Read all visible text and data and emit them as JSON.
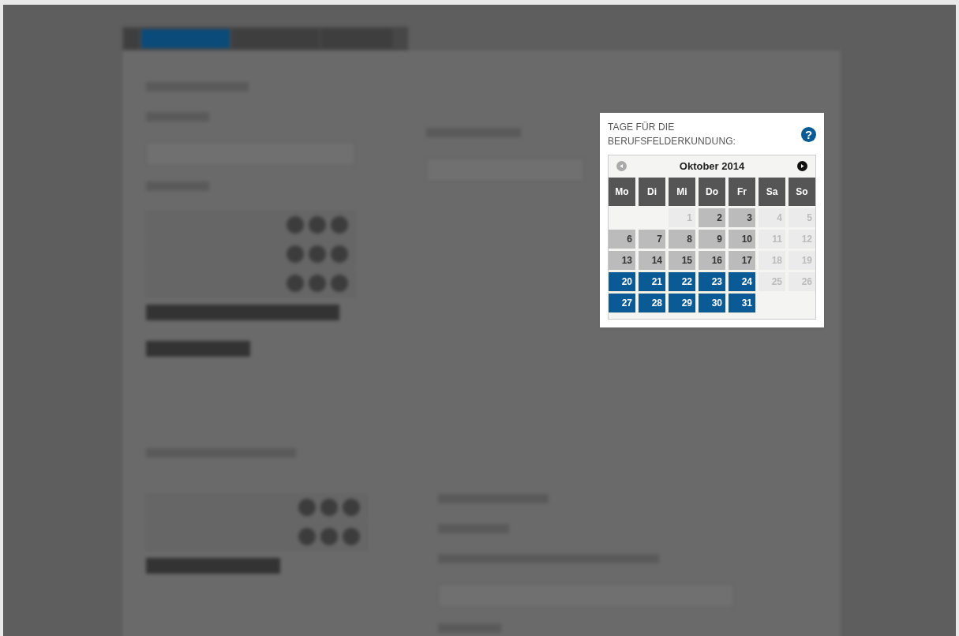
{
  "popup": {
    "title": "TAGE FÜR DIE BERUFSFELDERKUNDUNG:",
    "help": "?"
  },
  "calendar": {
    "month": "Oktober 2014",
    "prev_disabled": true,
    "next_disabled": false,
    "weekdays": [
      "Mo",
      "Di",
      "Mi",
      "Do",
      "Fr",
      "Sa",
      "So"
    ],
    "weeks": [
      {
        "days": [
          {
            "label": "1",
            "kind": "unavailable",
            "selected": false
          },
          {
            "label": "2",
            "kind": "available",
            "selected": false
          },
          {
            "label": "3",
            "kind": "available",
            "selected": false
          },
          {
            "label": "4",
            "kind": "unavailable",
            "selected": false
          },
          {
            "label": "5",
            "kind": "unavailable",
            "selected": false
          }
        ]
      },
      {
        "days": [
          {
            "label": "6",
            "kind": "available",
            "selected": false
          },
          {
            "label": "7",
            "kind": "available",
            "selected": false
          },
          {
            "label": "8",
            "kind": "available",
            "selected": false
          },
          {
            "label": "9",
            "kind": "available",
            "selected": false
          },
          {
            "label": "10",
            "kind": "available",
            "selected": false
          },
          {
            "label": "11",
            "kind": "unavailable",
            "selected": false
          },
          {
            "label": "12",
            "kind": "unavailable",
            "selected": false
          }
        ]
      },
      {
        "days": [
          {
            "label": "13",
            "kind": "available",
            "selected": false
          },
          {
            "label": "14",
            "kind": "available",
            "selected": false
          },
          {
            "label": "15",
            "kind": "available",
            "selected": false
          },
          {
            "label": "16",
            "kind": "available",
            "selected": false
          },
          {
            "label": "17",
            "kind": "available",
            "selected": false
          },
          {
            "label": "18",
            "kind": "unavailable",
            "selected": false
          },
          {
            "label": "19",
            "kind": "unavailable",
            "selected": false
          }
        ]
      },
      {
        "days": [
          {
            "label": "20",
            "kind": "available",
            "selected": true
          },
          {
            "label": "21",
            "kind": "available",
            "selected": true
          },
          {
            "label": "22",
            "kind": "available",
            "selected": true
          },
          {
            "label": "23",
            "kind": "available",
            "selected": true
          },
          {
            "label": "24",
            "kind": "available",
            "selected": true
          },
          {
            "label": "25",
            "kind": "unavailable",
            "selected": false
          },
          {
            "label": "26",
            "kind": "unavailable",
            "selected": false
          }
        ]
      },
      {
        "days": [
          {
            "label": "27",
            "kind": "available",
            "selected": true
          },
          {
            "label": "28",
            "kind": "available",
            "selected": true
          },
          {
            "label": "29",
            "kind": "available",
            "selected": true
          },
          {
            "label": "30",
            "kind": "available",
            "selected": true
          },
          {
            "label": "31",
            "kind": "available",
            "selected": true
          }
        ]
      }
    ]
  }
}
